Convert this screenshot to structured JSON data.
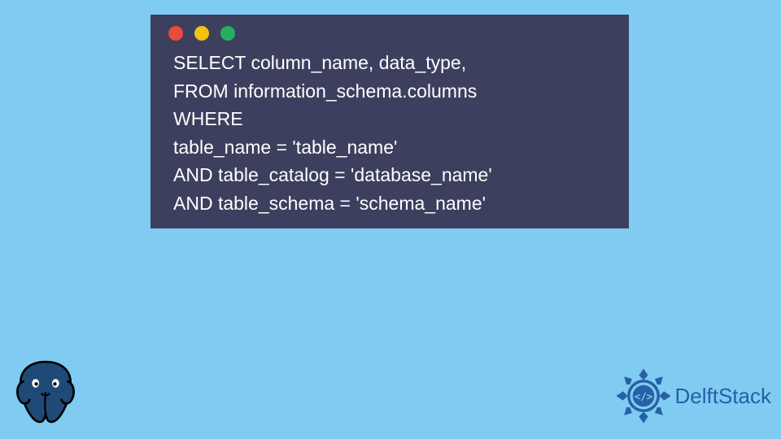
{
  "code": {
    "line1": "SELECT column_name, data_type,",
    "line2": "FROM information_schema.columns",
    "line3": "WHERE",
    "line4": "table_name = 'table_name'",
    "line5": "AND table_catalog = 'database_name'",
    "line6": "AND table_schema = 'schema_name'"
  },
  "brand": {
    "name": "DelftStack"
  },
  "colors": {
    "background": "#7fcbf2",
    "window": "#3d3f5e",
    "dot_red": "#e74c3c",
    "dot_yellow": "#f1c40f",
    "dot_green": "#27ae60",
    "brand_blue": "#2760a4"
  }
}
